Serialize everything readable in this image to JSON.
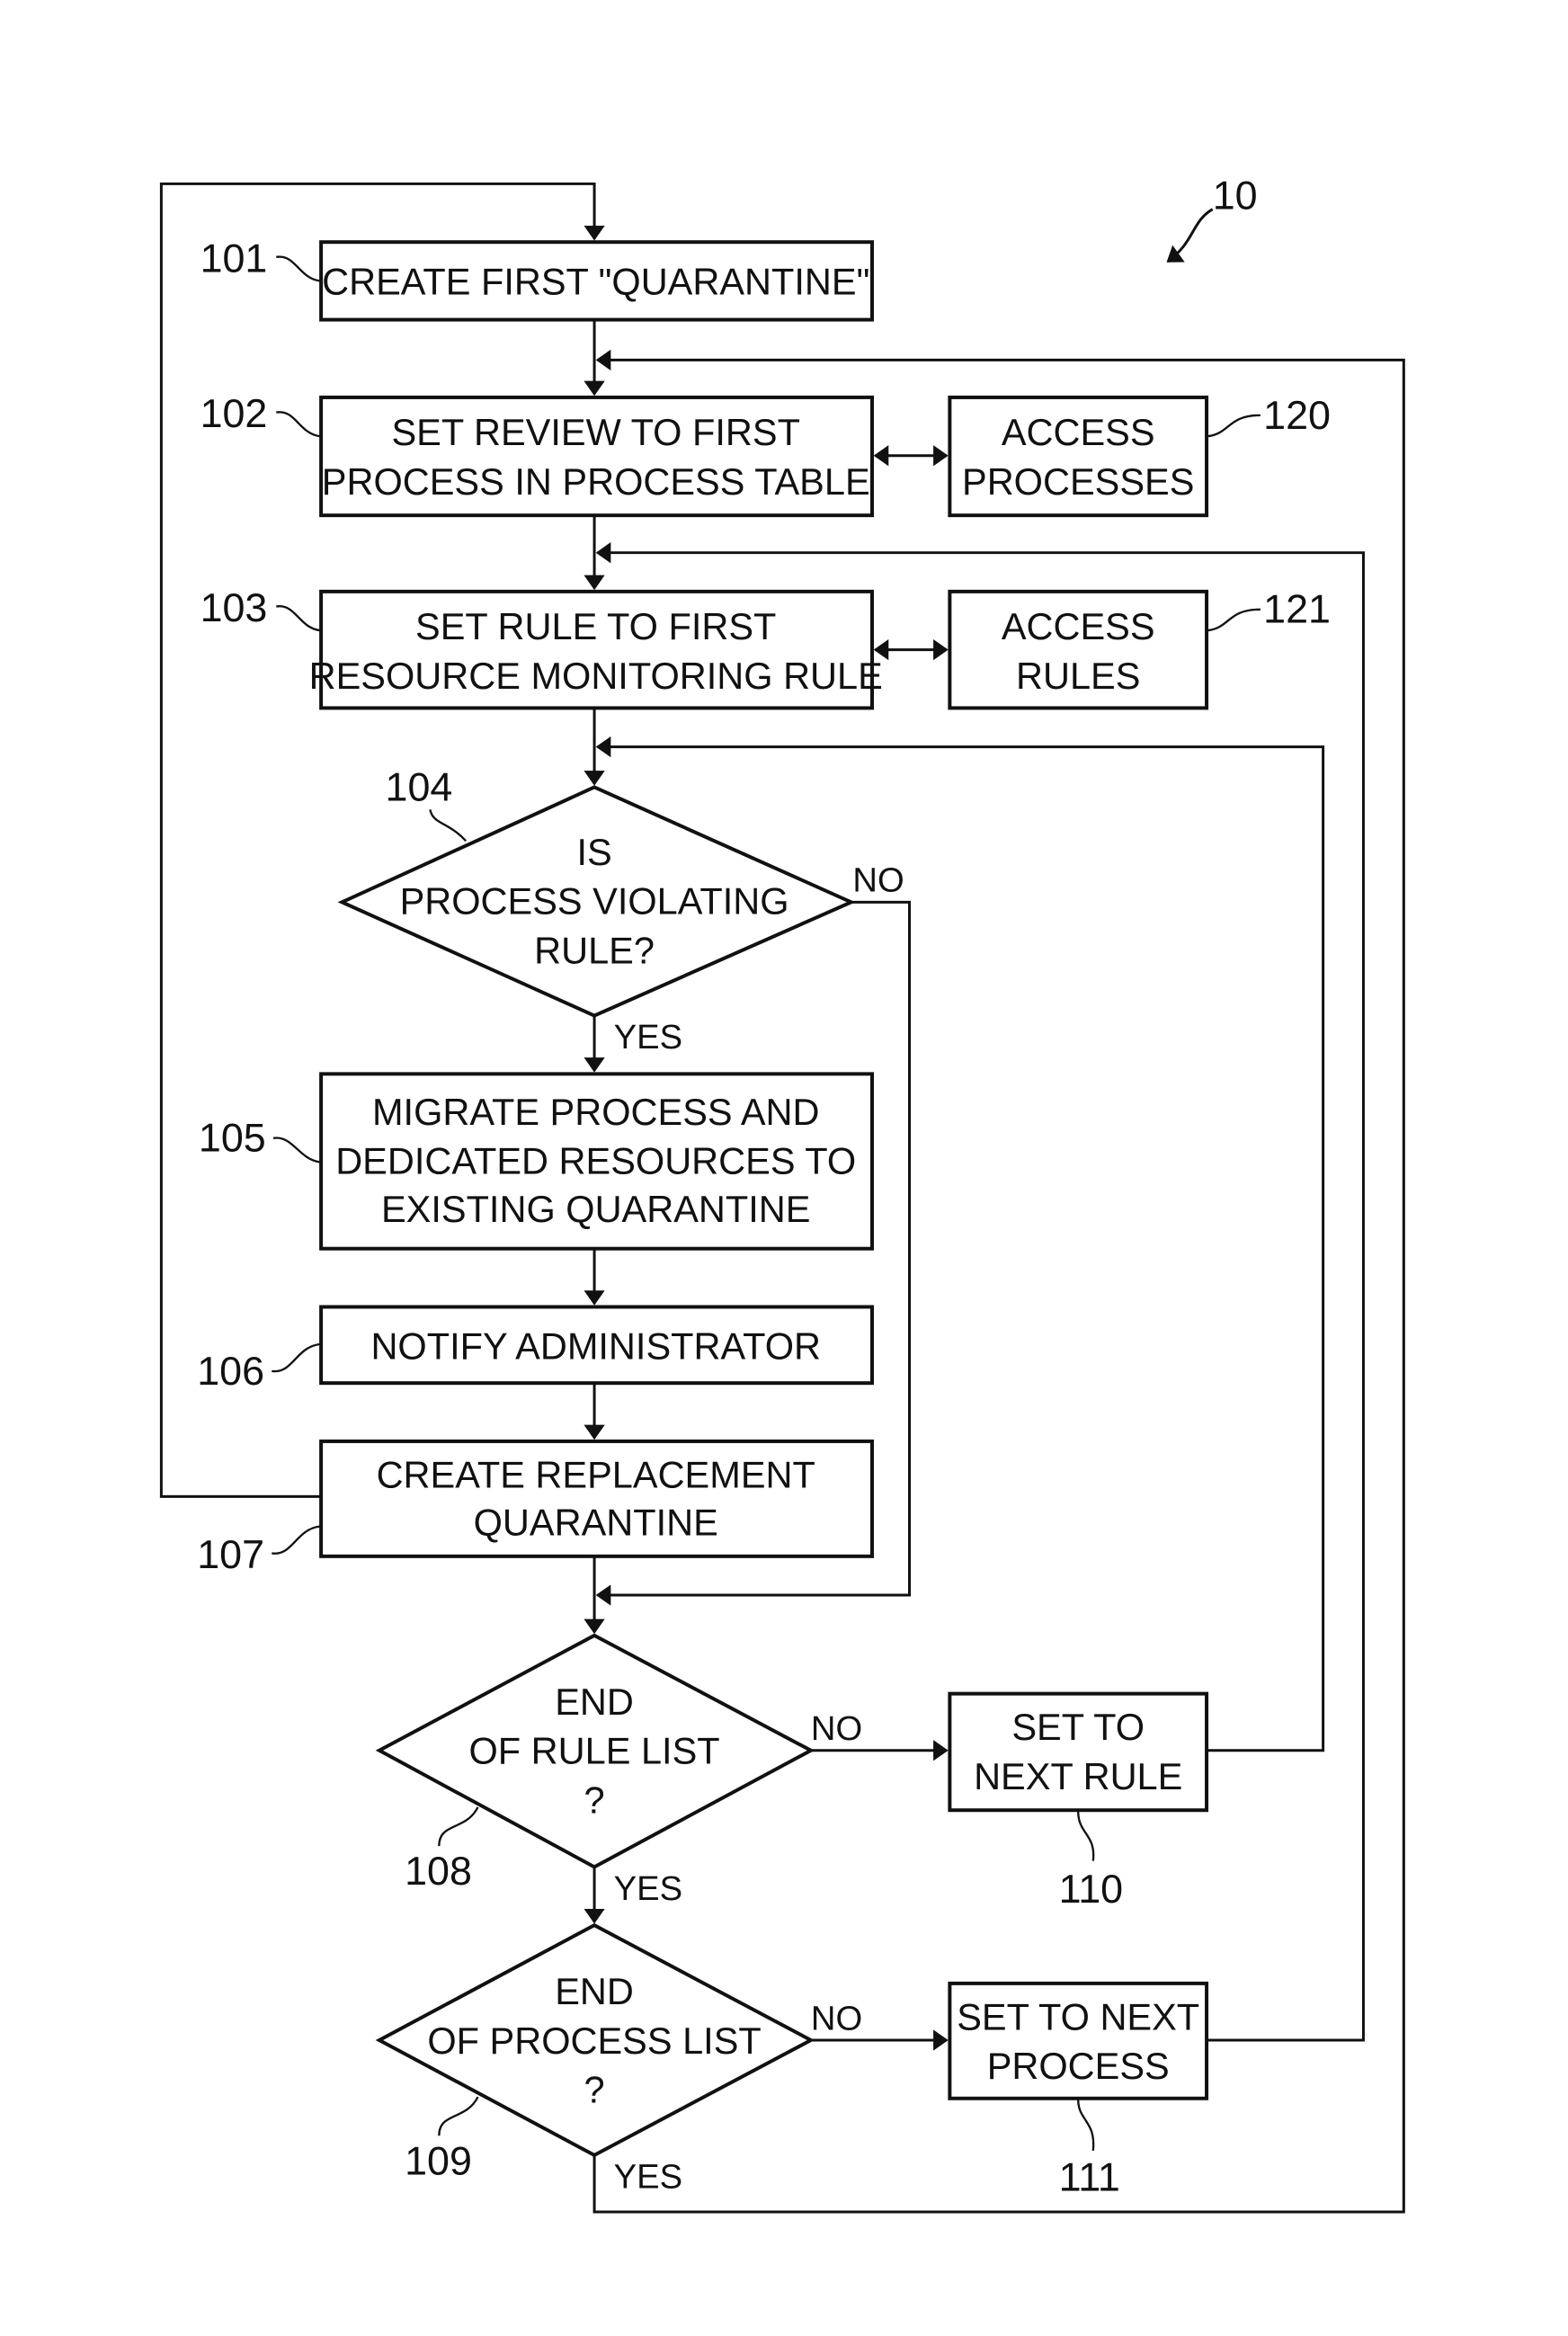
{
  "figure_label": "10",
  "steps": {
    "s101": {
      "ref": "101",
      "lines": [
        "CREATE FIRST \"QUARANTINE\""
      ]
    },
    "s102": {
      "ref": "102",
      "lines": [
        "SET REVIEW TO FIRST",
        "PROCESS IN PROCESS TABLE"
      ]
    },
    "s103": {
      "ref": "103",
      "lines": [
        "SET RULE TO FIRST",
        "RESOURCE MONITORING RULE"
      ]
    },
    "s104": {
      "ref": "104",
      "lines": [
        "IS",
        "PROCESS VIOLATING",
        "RULE?"
      ]
    },
    "s105": {
      "ref": "105",
      "lines": [
        "MIGRATE PROCESS AND",
        "DEDICATED RESOURCES TO",
        "EXISTING QUARANTINE"
      ]
    },
    "s106": {
      "ref": "106",
      "lines": [
        "NOTIFY ADMINISTRATOR"
      ]
    },
    "s107": {
      "ref": "107",
      "lines": [
        "CREATE REPLACEMENT",
        "QUARANTINE"
      ]
    },
    "s108": {
      "ref": "108",
      "lines": [
        "END",
        "OF RULE LIST",
        "?"
      ]
    },
    "s109": {
      "ref": "109",
      "lines": [
        "END",
        "OF PROCESS LIST",
        "?"
      ]
    },
    "s110": {
      "ref": "110",
      "lines": [
        "SET TO",
        "NEXT RULE"
      ]
    },
    "s111": {
      "ref": "111",
      "lines": [
        "SET TO NEXT",
        "PROCESS"
      ]
    },
    "s120": {
      "ref": "120",
      "lines": [
        "ACCESS",
        "PROCESSES"
      ]
    },
    "s121": {
      "ref": "121",
      "lines": [
        "ACCESS",
        "RULES"
      ]
    }
  },
  "branches": {
    "yes": "YES",
    "no": "NO"
  }
}
